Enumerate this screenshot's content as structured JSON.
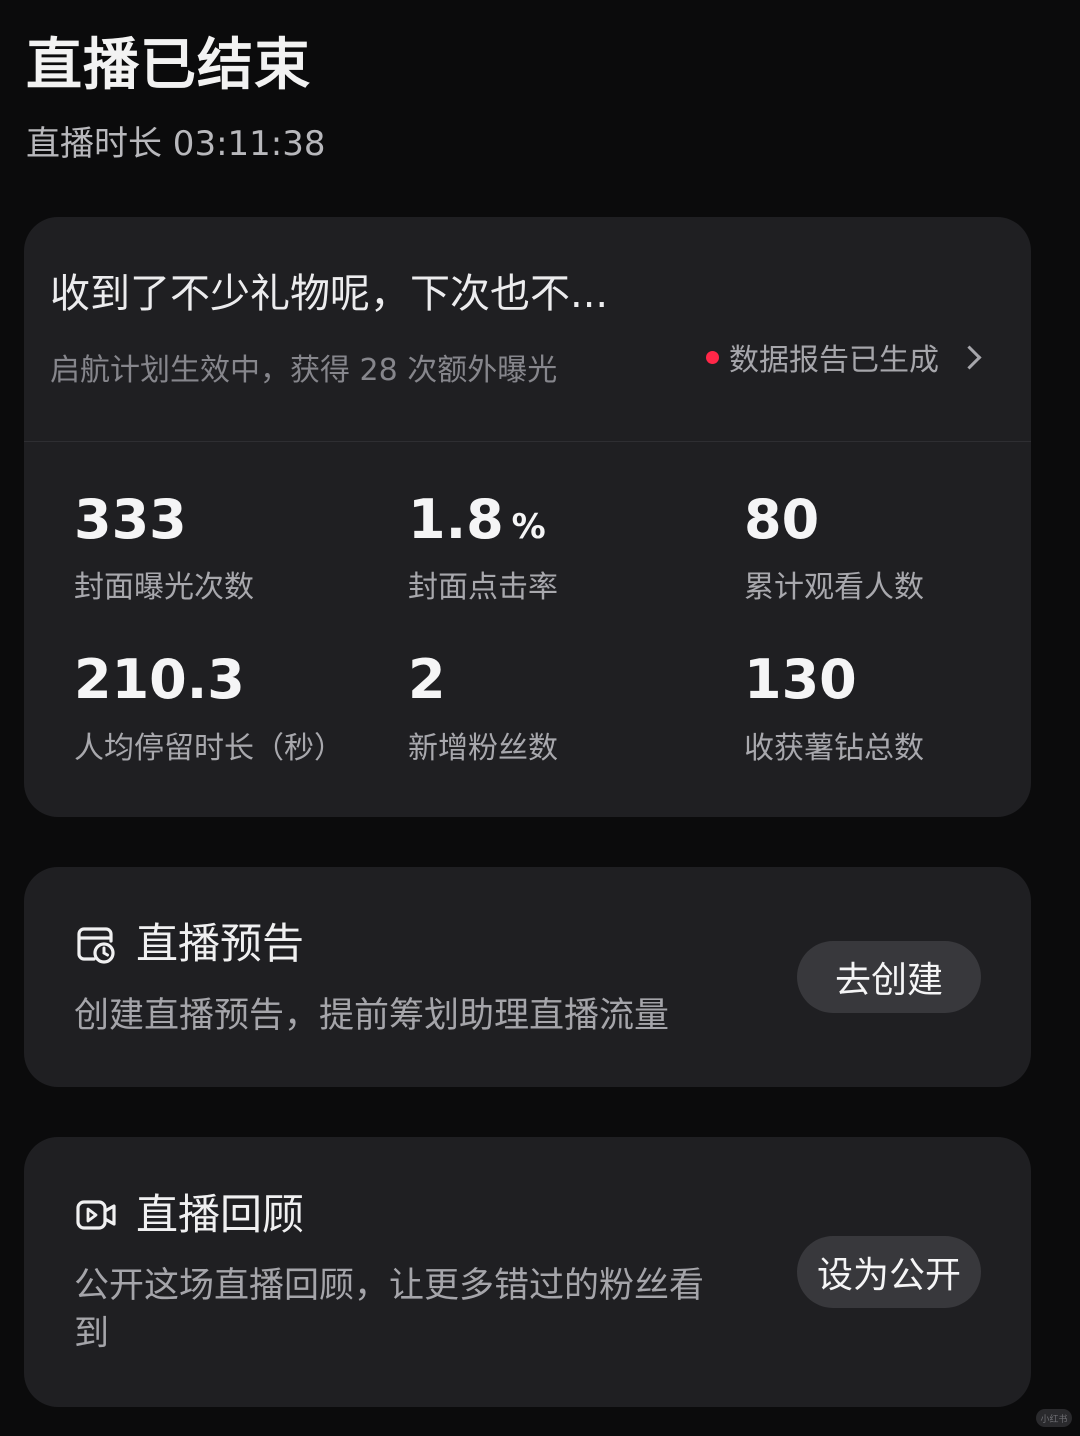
{
  "header": {
    "title": "直播已结束",
    "duration": "直播时长 03:11:38"
  },
  "summary": {
    "headline": "收到了不少礼物呢，下次也不...",
    "subtitle": "启航计划生效中，获得 28 次额外曝光",
    "report_link": "数据报告已生成"
  },
  "stats": [
    {
      "value": "333",
      "unit": "",
      "label": "封面曝光次数"
    },
    {
      "value": "1.8",
      "unit": "%",
      "label": "封面点击率"
    },
    {
      "value": "80",
      "unit": "",
      "label": "累计观看人数"
    },
    {
      "value": "210.3",
      "unit": "",
      "label": "人均停留时长（秒）"
    },
    {
      "value": "2",
      "unit": "",
      "label": "新增粉丝数"
    },
    {
      "value": "130",
      "unit": "",
      "label": "收获薯钻总数"
    }
  ],
  "preview": {
    "title": "直播预告",
    "description": "创建直播预告，提前筹划助理直播流量",
    "button": "去创建",
    "icon": "calendar-clock-icon"
  },
  "replay": {
    "title": "直播回顾",
    "description_line1": "公开这场直播回顾，让更多错过的粉丝看",
    "description_line2": "到",
    "button": "设为公开",
    "icon": "video-camera-icon"
  },
  "watermark": "小红书",
  "colors": {
    "background": "#0b0b0c",
    "card": "#1f1f22",
    "accent_dot": "#ff2748",
    "button": "#38383c"
  }
}
